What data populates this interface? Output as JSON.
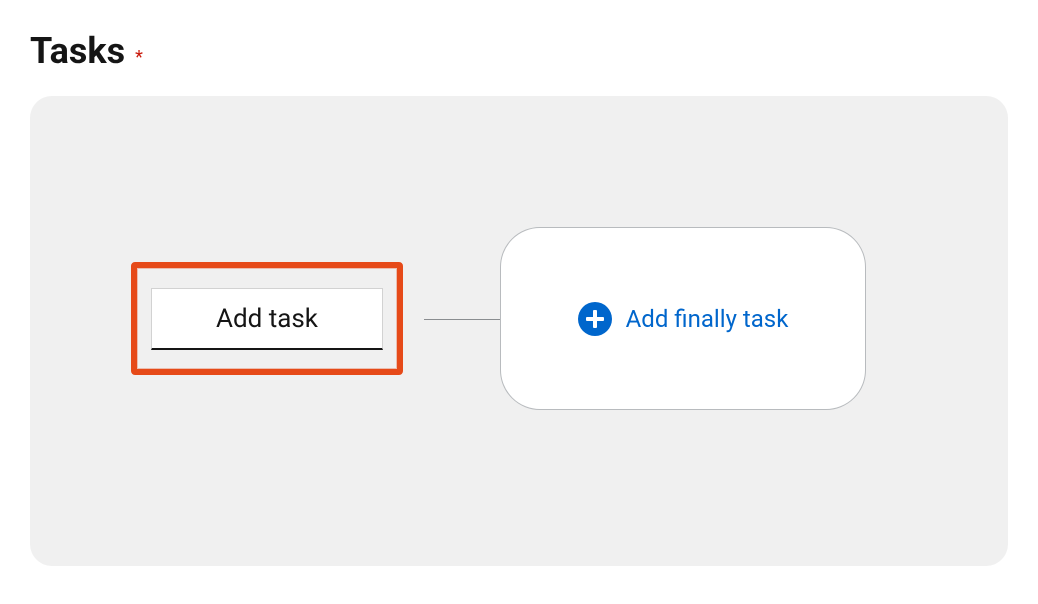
{
  "header": {
    "title": "Tasks",
    "required_marker": "*"
  },
  "add_task": {
    "label": "Add task"
  },
  "finally_task": {
    "label": "Add finally task"
  },
  "colors": {
    "accent_blue": "#0066cc",
    "highlight_red": "#e64a19",
    "required_red": "#c9190b"
  }
}
